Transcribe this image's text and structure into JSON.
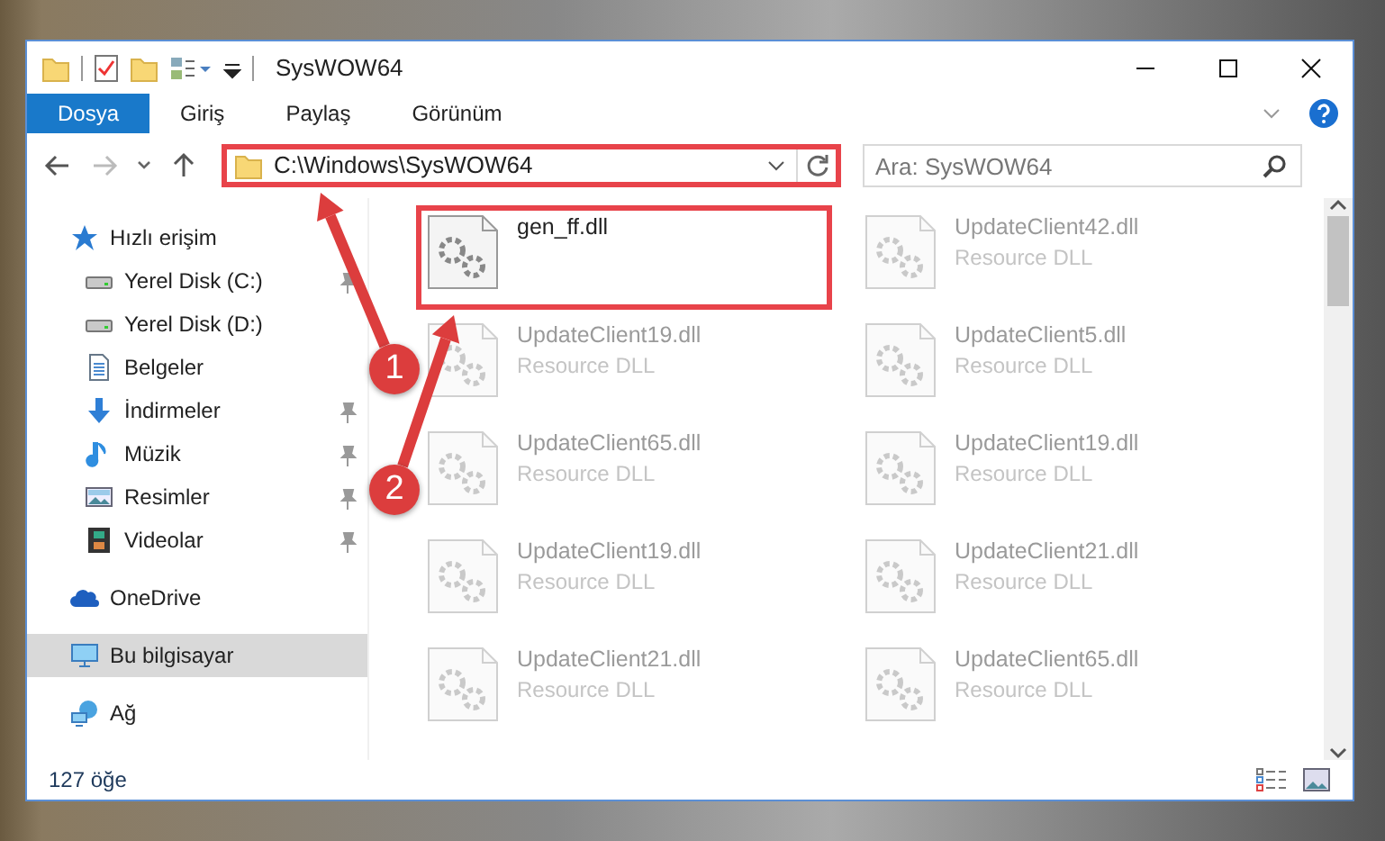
{
  "window": {
    "title": "SysWOW64"
  },
  "ribbon_tabs": [
    {
      "label": "Dosya",
      "selected": true
    },
    {
      "label": "Giriş",
      "selected": false
    },
    {
      "label": "Paylaş",
      "selected": false
    },
    {
      "label": "Görünüm",
      "selected": false
    }
  ],
  "address": {
    "path": "C:\\Windows\\SysWOW64",
    "highlighted": true
  },
  "search": {
    "placeholder": "Ara: SysWOW64"
  },
  "sidebar": {
    "items": [
      {
        "label": "Hızlı erişim",
        "kind": "star",
        "selected": false,
        "children": [
          {
            "label": "Yerel Disk (C:)",
            "kind": "drive",
            "pinned": true,
            "selected": false
          },
          {
            "label": "Yerel Disk (D:)",
            "kind": "drive",
            "pinned": false,
            "selected": false
          },
          {
            "label": "Belgeler",
            "kind": "document",
            "pinned": false,
            "selected": false
          },
          {
            "label": "İndirmeler",
            "kind": "download",
            "pinned": true,
            "selected": false
          },
          {
            "label": "Müzik",
            "kind": "music",
            "pinned": true,
            "selected": false
          },
          {
            "label": "Resimler",
            "kind": "picture",
            "pinned": true,
            "selected": false
          },
          {
            "label": "Videolar",
            "kind": "film",
            "pinned": true,
            "selected": false
          }
        ]
      },
      {
        "label": "OneDrive",
        "kind": "cloud",
        "selected": false
      },
      {
        "label": "Bu bilgisayar",
        "kind": "monitor",
        "selected": true
      },
      {
        "label": "Ağ",
        "kind": "network",
        "selected": false
      }
    ]
  },
  "files": [
    {
      "name": "gen_ff.dll",
      "blurred": false,
      "highlighted": true
    },
    {
      "name": "UpdateClient42.dll",
      "type": "Resource DLL",
      "blurred": true,
      "highlighted": false
    },
    {
      "name": "UpdateClient19.dll",
      "type": "Resource DLL",
      "blurred": true,
      "highlighted": false
    },
    {
      "name": "UpdateClient5.dll",
      "type": "Resource DLL",
      "blurred": true,
      "highlighted": false
    },
    {
      "name": "UpdateClient65.dll",
      "type": "Resource DLL",
      "blurred": true,
      "highlighted": false
    },
    {
      "name": "UpdateClient19.dll",
      "type": "Resource DLL",
      "blurred": true,
      "highlighted": false
    },
    {
      "name": "UpdateClient19.dll",
      "type": "Resource DLL",
      "blurred": true,
      "highlighted": false
    },
    {
      "name": "UpdateClient21.dll",
      "type": "Resource DLL",
      "blurred": true,
      "highlighted": false
    },
    {
      "name": "UpdateClient21.dll",
      "type": "Resource DLL",
      "blurred": true,
      "highlighted": false
    },
    {
      "name": "UpdateClient65.dll",
      "type": "Resource DLL",
      "blurred": true,
      "highlighted": false
    }
  ],
  "status_bar": {
    "count": "127 öğe"
  },
  "annotations": [
    {
      "number": "1"
    },
    {
      "number": "2"
    }
  ]
}
